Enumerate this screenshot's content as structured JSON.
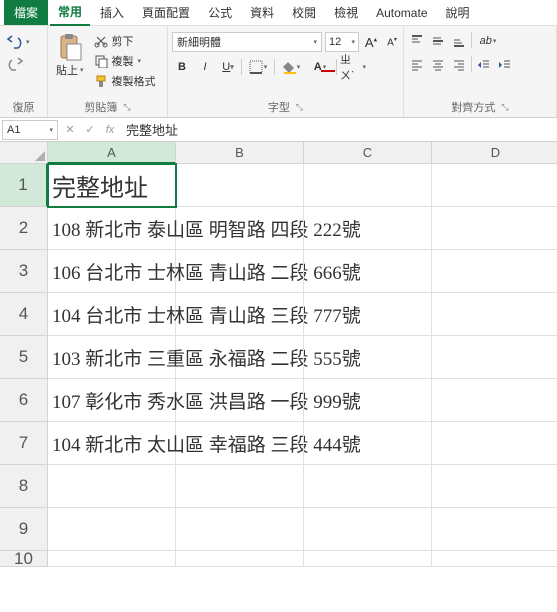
{
  "menu": {
    "file": "檔案",
    "home": "常用",
    "insert": "插入",
    "page_layout": "頁面配置",
    "formulas": "公式",
    "data": "資料",
    "review": "校閱",
    "view": "檢視",
    "automate": "Automate",
    "help": "說明"
  },
  "ribbon": {
    "undo_label": "復原",
    "clipboard_label": "剪貼簿",
    "paste": "貼上",
    "cut": "剪下",
    "copy": "複製",
    "format_painter": "複製格式",
    "font_label": "字型",
    "font_name": "新細明體",
    "font_size": "12",
    "alignment_label": "對齊方式"
  },
  "namebox": "A1",
  "formula": "完整地址",
  "cols": [
    "A",
    "B",
    "C",
    "D"
  ],
  "rows": [
    {
      "n": "1",
      "a": "完整地址"
    },
    {
      "n": "2",
      "a": "108 新北市 泰山區 明智路 四段 222號"
    },
    {
      "n": "3",
      "a": "106 台北市 士林區 青山路 二段 666號"
    },
    {
      "n": "4",
      "a": "104 台北市 士林區 青山路 三段 777號"
    },
    {
      "n": "5",
      "a": "103 新北市 三重區 永福路 二段 555號"
    },
    {
      "n": "6",
      "a": "107 彰化市 秀水區 洪昌路 一段 999號"
    },
    {
      "n": "7",
      "a": "104 新北市 太山區 幸福路 三段 444號"
    },
    {
      "n": "8",
      "a": ""
    },
    {
      "n": "9",
      "a": ""
    },
    {
      "n": "10",
      "a": ""
    }
  ]
}
